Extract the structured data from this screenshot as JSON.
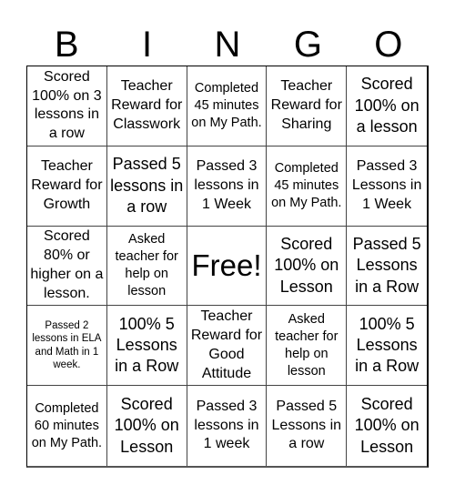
{
  "header": {
    "letters": [
      "B",
      "I",
      "N",
      "G",
      "O"
    ]
  },
  "cells": [
    "Scored 100% on 3 lessons in a row",
    "Teacher Reward for Classwork",
    "Completed 45 minutes on My Path.",
    "Teacher Reward for Sharing",
    "Scored 100% on a lesson",
    "Teacher Reward for Growth",
    "Passed 5 lessons in a row",
    "Passed 3 lessons in 1 Week",
    "Completed 45 minutes on My Path.",
    "Passed 3 Lessons in 1 Week",
    "Scored 80% or higher on a lesson.",
    "Asked teacher for help on lesson",
    "Free!",
    "Scored 100% on Lesson",
    "Passed 5 Lessons in a Row",
    "Passed 2 lessons in ELA and Math in 1 week.",
    "100% 5 Lessons in a Row",
    "Teacher Reward for Good Attitude",
    "Asked teacher for help on lesson",
    "100% 5 Lessons in a Row",
    "Completed 60 minutes on My Path.",
    "Scored 100% on Lesson",
    "Passed 3 lessons in 1 week",
    "Passed 5 Lessons in a row",
    "Scored 100% on Lesson"
  ]
}
